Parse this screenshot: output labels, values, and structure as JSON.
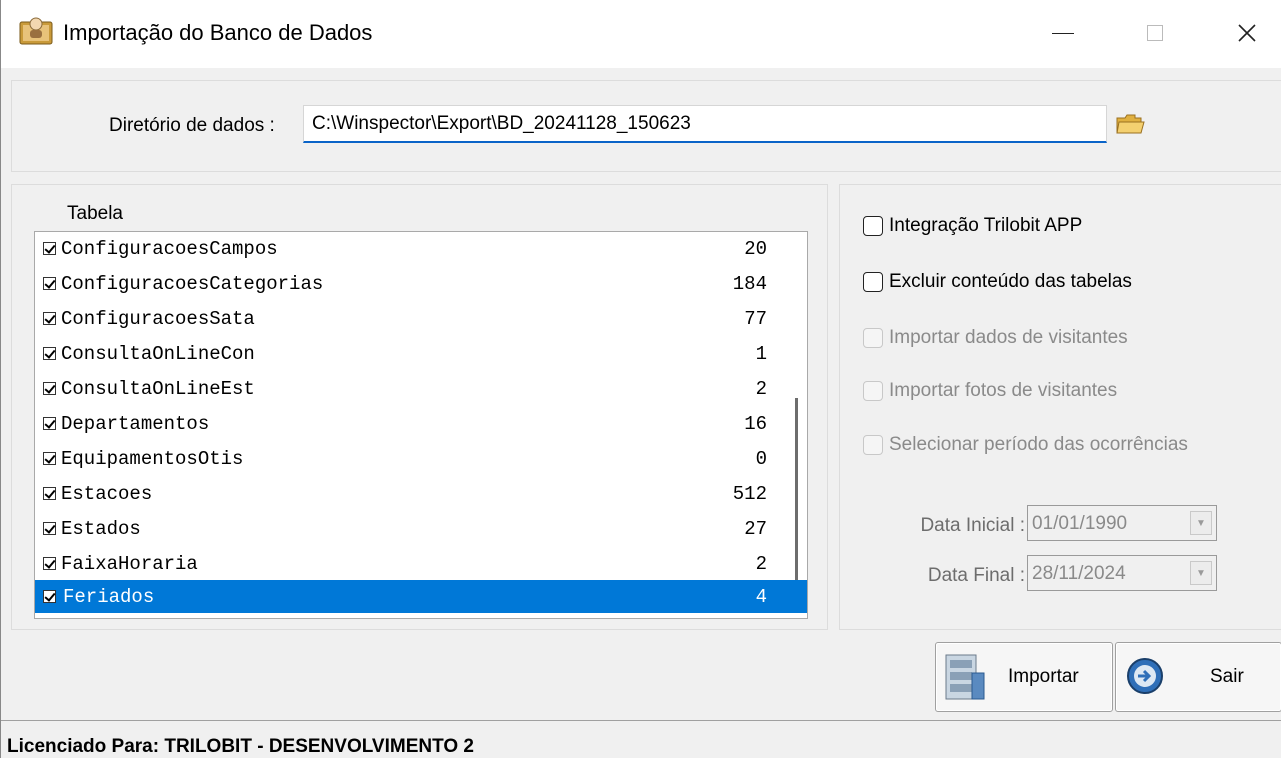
{
  "window": {
    "title": "Importação do Banco de Dados",
    "controls": {
      "minimize": "—",
      "close": "✕"
    }
  },
  "directory": {
    "label": "Diretório de dados :",
    "value": "C:\\Winspector\\Export\\BD_20241128_150623"
  },
  "table": {
    "header": "Tabela",
    "items": [
      {
        "name": "ConfiguracoesCampos",
        "count": "20",
        "checked": true
      },
      {
        "name": "ConfiguracoesCategorias",
        "count": "184",
        "checked": true
      },
      {
        "name": "ConfiguracoesSata",
        "count": "77",
        "checked": true
      },
      {
        "name": "ConsultaOnLineCon",
        "count": "1",
        "checked": true
      },
      {
        "name": "ConsultaOnLineEst",
        "count": "2",
        "checked": true
      },
      {
        "name": "Departamentos",
        "count": "16",
        "checked": true
      },
      {
        "name": "EquipamentosOtis",
        "count": "0",
        "checked": true
      },
      {
        "name": "Estacoes",
        "count": "512",
        "checked": true
      },
      {
        "name": "Estados",
        "count": "27",
        "checked": true
      },
      {
        "name": "FaixaHoraria",
        "count": "2",
        "checked": true
      },
      {
        "name": "Feriados",
        "count": "4",
        "checked": true,
        "selected": true
      }
    ]
  },
  "options": {
    "integracao": "Integração Trilobit APP",
    "excluir": "Excluir conteúdo das tabelas",
    "importar_dados": "Importar dados de visitantes",
    "importar_fotos": "Importar fotos de visitantes",
    "selecionar_periodo": "Selecionar período das ocorrências"
  },
  "dates": {
    "initial_label": "Data Inicial :",
    "initial_value": "01/01/1990",
    "final_label": "Data Final :",
    "final_value": "28/11/2024"
  },
  "buttons": {
    "import": "Importar",
    "exit": "Sair"
  },
  "status": {
    "license": "Licenciado Para: TRILOBIT - DESENVOLVIMENTO 2"
  }
}
